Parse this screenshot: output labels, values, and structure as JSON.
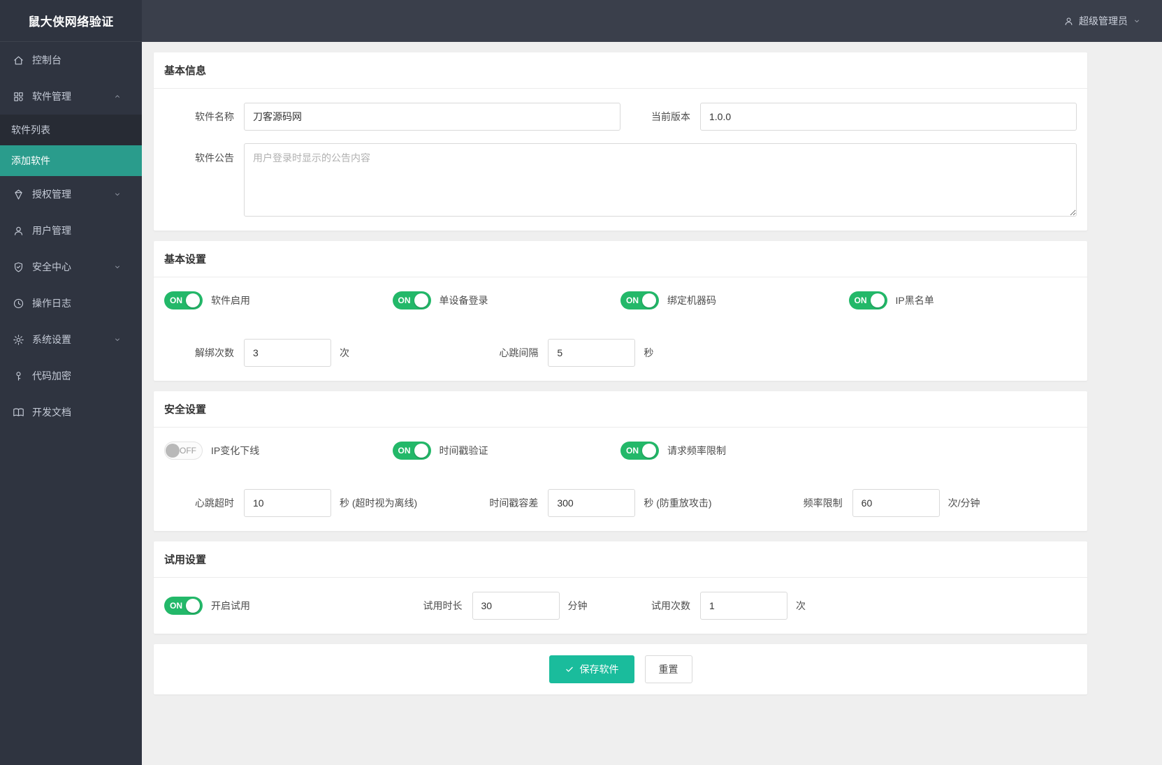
{
  "app": {
    "title": "鼠大侠网络验证"
  },
  "header": {
    "user_label": "超级管理员"
  },
  "colors": {
    "accent_teal": "#1abc9c",
    "toggle_green": "#23b869",
    "sidebar_active": "#2a9c8c"
  },
  "sidebar": {
    "items": [
      {
        "label": "控制台",
        "icon": "home-icon"
      },
      {
        "label": "软件管理",
        "icon": "apps-icon",
        "expanded": true,
        "children": [
          {
            "label": "软件列表"
          },
          {
            "label": "添加软件",
            "active": true
          }
        ]
      },
      {
        "label": "授权管理",
        "icon": "gem-icon"
      },
      {
        "label": "用户管理",
        "icon": "user-icon"
      },
      {
        "label": "安全中心",
        "icon": "shield-check-icon"
      },
      {
        "label": "操作日志",
        "icon": "clock-icon"
      },
      {
        "label": "系统设置",
        "icon": "gear-icon"
      },
      {
        "label": "代码加密",
        "icon": "key-icon"
      },
      {
        "label": "开发文档",
        "icon": "book-icon"
      }
    ]
  },
  "sections": {
    "basic_info": {
      "title": "基本信息",
      "software_name": {
        "label": "软件名称",
        "value": "刀客源码网"
      },
      "current_version": {
        "label": "当前版本",
        "value": "1.0.0"
      },
      "announcement": {
        "label": "软件公告",
        "placeholder": "用户登录时显示的公告内容",
        "value": ""
      }
    },
    "basic_settings": {
      "title": "基本设置",
      "toggles": [
        {
          "label": "软件启用",
          "state": "ON"
        },
        {
          "label": "单设备登录",
          "state": "ON"
        },
        {
          "label": "绑定机器码",
          "state": "ON"
        },
        {
          "label": "IP黑名单",
          "state": "ON"
        }
      ],
      "fields": [
        {
          "label": "解绑次数",
          "value": "3",
          "unit": "次"
        },
        {
          "label": "心跳间隔",
          "value": "5",
          "unit": "秒"
        }
      ]
    },
    "security_settings": {
      "title": "安全设置",
      "toggles": [
        {
          "label": "IP变化下线",
          "state": "OFF"
        },
        {
          "label": "时间戳验证",
          "state": "ON"
        },
        {
          "label": "请求频率限制",
          "state": "ON"
        }
      ],
      "fields": [
        {
          "label": "心跳超时",
          "value": "10",
          "unit": "秒 (超时视为离线)"
        },
        {
          "label": "时间戳容差",
          "value": "300",
          "unit": "秒 (防重放攻击)"
        },
        {
          "label": "频率限制",
          "value": "60",
          "unit": "次/分钟"
        }
      ]
    },
    "trial_settings": {
      "title": "试用设置",
      "toggles": [
        {
          "label": "开启试用",
          "state": "ON"
        }
      ],
      "fields": [
        {
          "label": "试用时长",
          "value": "30",
          "unit": "分钟"
        },
        {
          "label": "试用次数",
          "value": "1",
          "unit": "次"
        }
      ]
    },
    "actions": {
      "save_label": "保存软件",
      "reset_label": "重置"
    }
  }
}
